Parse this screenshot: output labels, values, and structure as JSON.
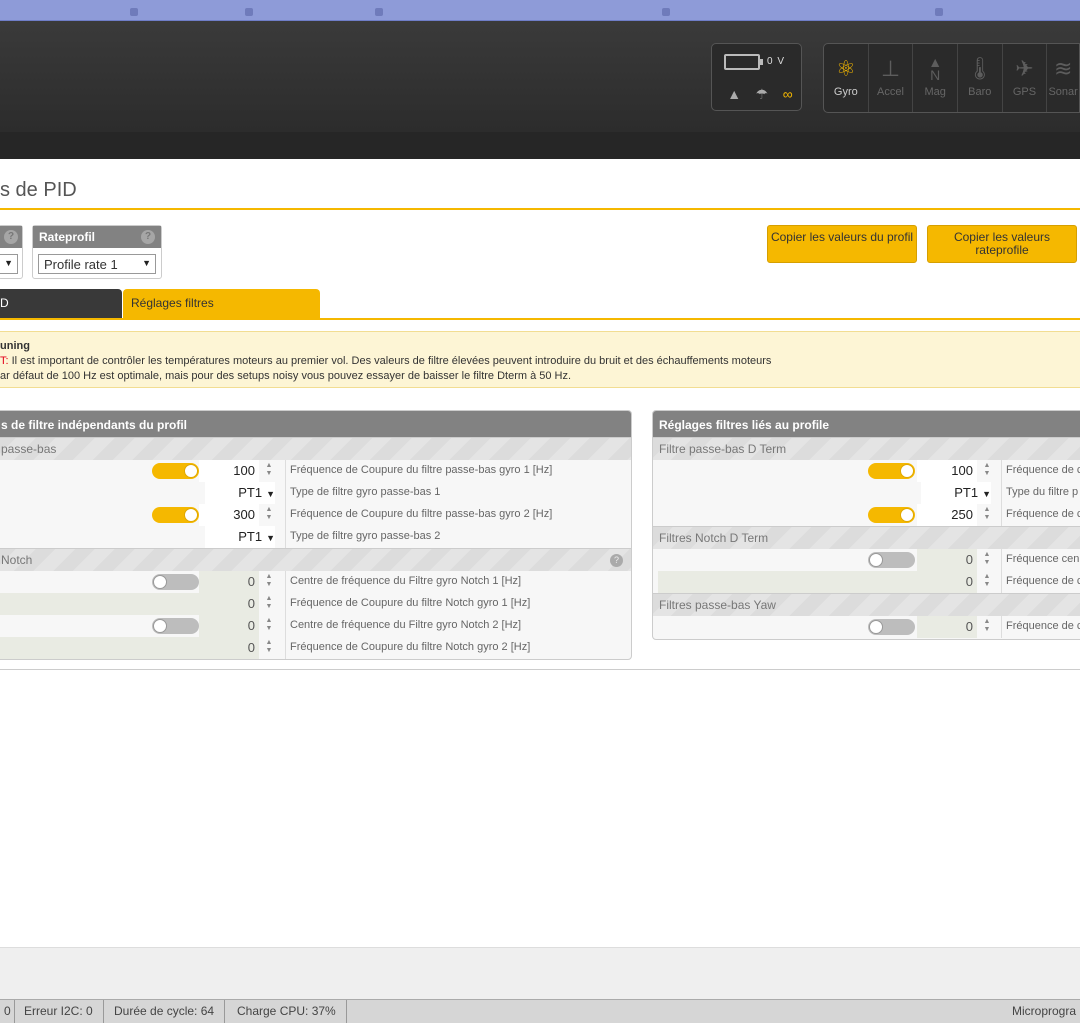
{
  "header": {
    "battery_voltage": "0 V",
    "sensors": [
      {
        "label": "Gyro",
        "icon": "gyro-icon",
        "active": true
      },
      {
        "label": "Accel",
        "icon": "accel-icon",
        "active": false
      },
      {
        "label": "Mag",
        "icon": "mag-icon",
        "active": false
      },
      {
        "label": "Baro",
        "icon": "baro-icon",
        "active": false
      },
      {
        "label": "GPS",
        "icon": "gps-icon",
        "active": false
      },
      {
        "label": "Sonar",
        "icon": "sonar-icon",
        "active": false
      }
    ]
  },
  "page": {
    "title": "s de PID",
    "rateprofile_label": "Rateprofil",
    "rateprofile_value": "Profile rate 1",
    "copy_profile_btn": "Copier les valeurs du profil",
    "copy_rateprofile_btn": "Copier les valeurs rateprofile",
    "tabs": {
      "first": "D",
      "active": "Réglages filtres"
    }
  },
  "note": {
    "heading": "uning",
    "warn_prefix": "T:",
    "line1": " Il est important de contrôler les températures moteurs au premier vol. Des valeurs de filtre élevées peuvent introduire du bruit et des échauffements moteurs",
    "line2": "ar défaut de 100 Hz est optimale, mais pour des setups noisy vous pouvez essayer de baisser le filtre Dterm à 50 Hz."
  },
  "left_panel": {
    "title": "s de filtre indépendants du profil",
    "sub1": " passe-bas",
    "sub2": " Notch",
    "rows": [
      {
        "value": "100",
        "desc": "Fréquence de Coupure du filtre passe-bas gyro 1 [Hz]"
      },
      {
        "value": "PT1",
        "desc": "Type de filtre gyro passe-bas 1"
      },
      {
        "value": "300",
        "desc": "Fréquence de Coupure du filtre passe-bas gyro 2 [Hz]"
      },
      {
        "value": "PT1",
        "desc": "Type de filtre gyro passe-bas 2"
      },
      {
        "value": "0",
        "desc": "Centre de fréquence du Filtre gyro Notch 1 [Hz]"
      },
      {
        "value": "0",
        "desc": "Fréquence de Coupure du filtre Notch gyro 1 [Hz]"
      },
      {
        "value": "0",
        "desc": "Centre de fréquence du Filtre gyro Notch 2 [Hz]"
      },
      {
        "value": "0",
        "desc": "Fréquence de Coupure du filtre Notch gyro 2 [Hz]"
      }
    ]
  },
  "right_panel": {
    "title": "Réglages filtres liés au profile",
    "sub1": "Filtre passe-bas D Term",
    "sub2": "Filtres Notch D Term",
    "sub3": "Filtres passe-bas Yaw",
    "rows": [
      {
        "value": "100",
        "desc": "Fréquence de c"
      },
      {
        "value": "PT1",
        "desc": "Type du filtre p"
      },
      {
        "value": "250",
        "desc": "Fréquence de c"
      },
      {
        "value": "0",
        "desc": "Fréquence cen"
      },
      {
        "value": "0",
        "desc": "Fréquence de c"
      },
      {
        "value": "0",
        "desc": "Fréquence de c"
      }
    ]
  },
  "statusbar": {
    "first": "0",
    "i2c": "Erreur I2C: 0",
    "cycle": "Durée de cycle: 64",
    "cpu": "Charge CPU: 37%",
    "firmware": "Microprogra"
  },
  "colors": {
    "accent": "#f5b800",
    "header": "#333333",
    "panel_header": "#828282"
  }
}
